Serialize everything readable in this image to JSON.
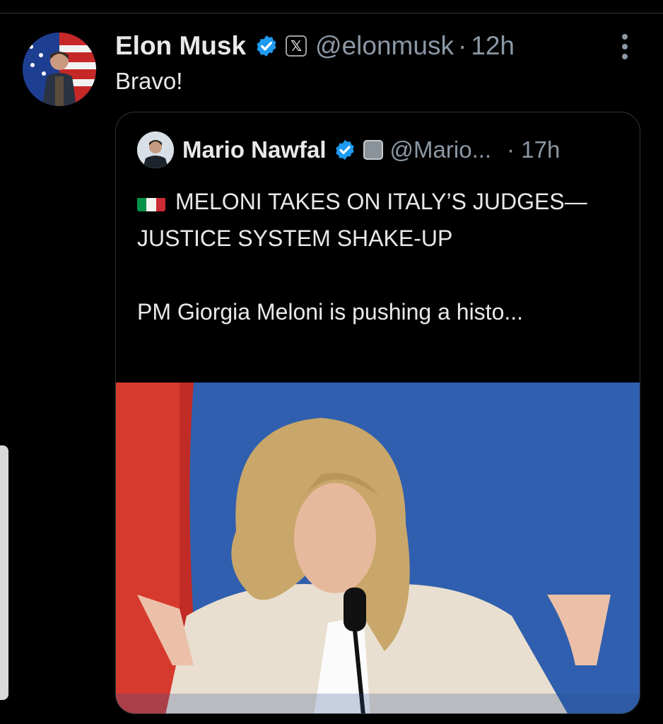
{
  "tweet": {
    "author_name": "Elon Musk",
    "handle": "@elonmusk",
    "separator": "·",
    "time": "12h",
    "text": "Bravo!"
  },
  "quote": {
    "author_name": "Mario Nawfal",
    "handle": "@Mario...",
    "time": "· 17h",
    "headline": "MELONI TAKES ON ITALY’S JUDGES—JUSTICE SYSTEM SHAKE-UP",
    "body": "PM Giorgia Meloni is pushing a histo..."
  },
  "icons": {
    "verified": "verified-badge-icon",
    "affiliation_main": "x-logo-icon",
    "affiliation_quote": "affiliate-badge-icon",
    "flag": "italy-flag-icon",
    "more": "more-vertical-icon"
  },
  "colors": {
    "background": "#000000",
    "text": "#e7e9ea",
    "secondary_text": "#8b98a5",
    "verified_blue": "#1d9bf0",
    "border": "#2f3336"
  }
}
